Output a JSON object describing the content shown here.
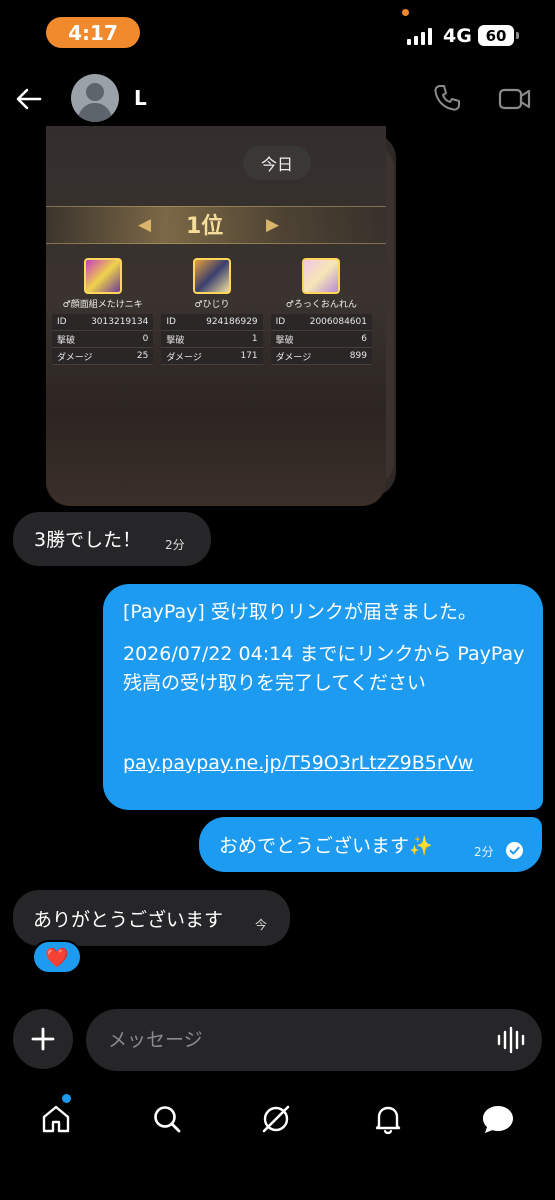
{
  "status_bar": {
    "time": "4:17",
    "network": "4G",
    "battery": "60"
  },
  "header": {
    "contact_name": "L"
  },
  "media": {
    "day_label": "今日",
    "rank_title": "1位",
    "players": [
      {
        "name": "♂顔面組メたけニキ",
        "id_label": "ID",
        "id": "3013219134",
        "kills_label": "撃破",
        "kills": "0",
        "damage_label": "ダメージ",
        "damage": "25"
      },
      {
        "name": "♂ひじり",
        "id_label": "ID",
        "id": "924186929",
        "kills_label": "撃破",
        "kills": "1",
        "damage_label": "ダメージ",
        "damage": "171"
      },
      {
        "name": "♂ろっくおんれん",
        "id_label": "ID",
        "id": "2006084601",
        "kills_label": "撃破",
        "kills": "6",
        "damage_label": "ダメージ",
        "damage": "899"
      }
    ]
  },
  "messages": {
    "received_1": {
      "text": "3勝でした！",
      "time": "2分"
    },
    "sent_paypay": {
      "line1": "[PayPay] 受け取りリンクが届きました。",
      "line2": "2026/07/22 04:14 までにリンクから PayPay 残高の受け取りを完了してください",
      "link": "pay.paypay.ne.jp/T59O3rLtzZ9B5rVw"
    },
    "sent_congrats": {
      "text": "おめでとうございます✨",
      "time": "2分"
    },
    "received_2": {
      "text": "ありがとうございます",
      "time": "今",
      "reaction": "❤️"
    }
  },
  "composer": {
    "placeholder": "メッセージ"
  },
  "colors": {
    "accent": "#1d9bf0",
    "time_pill": "#f08a2c",
    "bubble_received": "#262628"
  },
  "nav": [
    "home-icon",
    "search-icon",
    "grok-icon",
    "notifications-icon",
    "messages-icon"
  ]
}
